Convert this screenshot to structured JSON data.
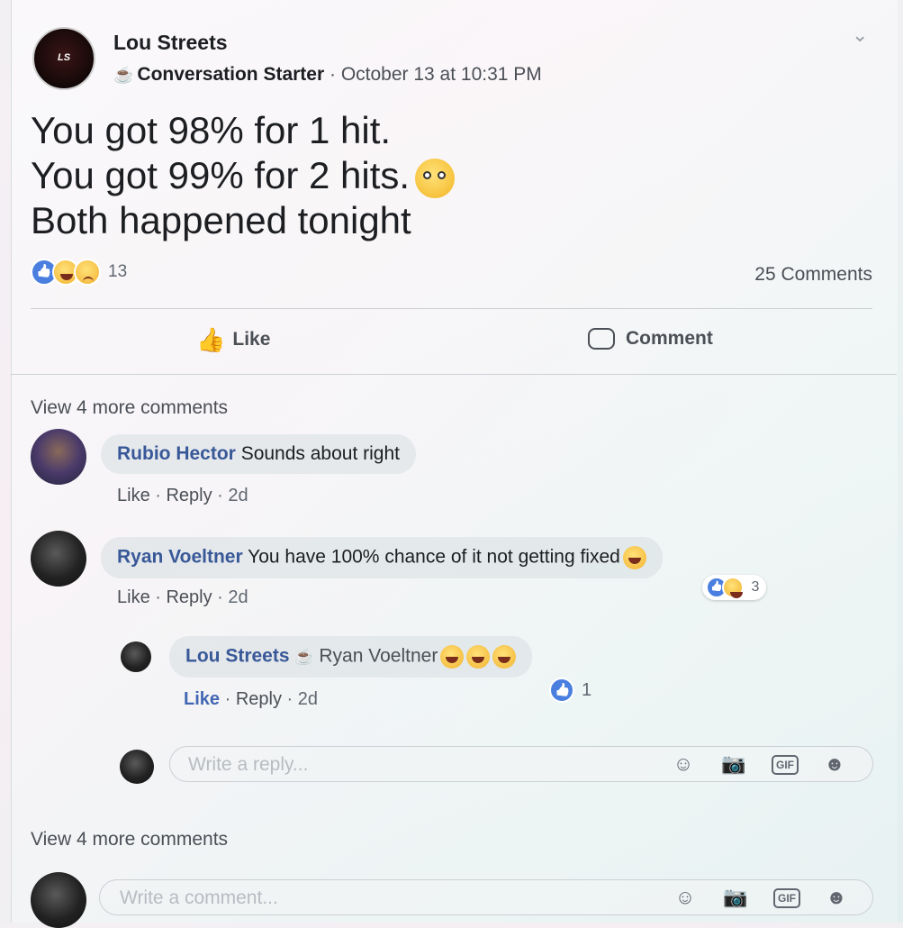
{
  "post": {
    "author": "Lou Streets",
    "badge_icon": "coffee-cup-icon",
    "badge": "Conversation Starter",
    "timestamp": "October 13 at 10:31 PM",
    "avatar_text": "LS",
    "lines": [
      "You got 98% for 1 hit.",
      "You got 99% for 2 hits.",
      "Both happened tonight"
    ],
    "reaction_count": "13",
    "comments_count": "25 Comments"
  },
  "actions": {
    "like": "Like",
    "comment": "Comment"
  },
  "view_more_top": "View 4 more comments",
  "comments": [
    {
      "author": "Rubio Hector",
      "text": "Sounds about right",
      "like": "Like",
      "reply": "Reply",
      "time": "2d"
    },
    {
      "author": "Ryan Voeltner",
      "text": "You have 100% chance of it not getting fixed",
      "like": "Like",
      "reply": "Reply",
      "time": "2d",
      "reactions": "3"
    }
  ],
  "reply": {
    "author": "Lou Streets",
    "mention": "Ryan Voeltner",
    "like": "Like",
    "reply": "Reply",
    "time": "2d",
    "reactions": "1"
  },
  "reply_input_placeholder": "Write a reply...",
  "view_more_bottom": "View 4 more comments",
  "comment_input_placeholder": "Write a comment...",
  "input_icons": {
    "gif": "GIF"
  }
}
